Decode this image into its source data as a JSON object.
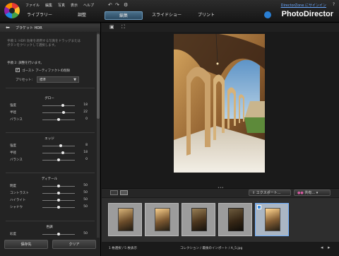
{
  "menu": [
    "ファイル",
    "編集",
    "写真",
    "表示",
    "ヘルプ"
  ],
  "signin": "DirectorZone にサインイン",
  "help": "?",
  "tabs": {
    "library": "ライブラリー",
    "adjust": "調整",
    "edit": "編集",
    "slideshow": "スライドショー",
    "print": "プリント"
  },
  "brand": "PhotoDirector",
  "panel": {
    "title": "ブラケット HDR",
    "intro": "手順 1: HDR 効果を適用する写真をドラッグまたは\nボタンをクリックして選択します。",
    "step2": "手順 2: 調整を行います。",
    "ghost_label": "ゴースト アーティファクトの削除",
    "preset_label": "プリセット:",
    "preset_value": "標準",
    "sections": [
      {
        "title": "グロー",
        "sliders": [
          {
            "label": "強度",
            "value": "18",
            "level": 0.62
          },
          {
            "label": "半径",
            "value": "22",
            "level": 0.66
          },
          {
            "label": "バランス",
            "value": "0",
            "level": 0.5
          }
        ]
      },
      {
        "title": "エッジ",
        "sliders": [
          {
            "label": "強度",
            "value": "8",
            "level": 0.56
          },
          {
            "label": "半径",
            "value": "18",
            "level": 0.62
          },
          {
            "label": "バランス",
            "value": "0",
            "level": 0.5
          }
        ]
      },
      {
        "title": "ディテール",
        "sliders": [
          {
            "label": "明度",
            "value": "50",
            "level": 0.5
          },
          {
            "label": "コントラスト",
            "value": "50",
            "level": 0.5
          },
          {
            "label": "ハイライト",
            "value": "50",
            "level": 0.5
          },
          {
            "label": "シャドウ",
            "value": "50",
            "level": 0.5
          }
        ]
      },
      {
        "title": "色調",
        "sliders": [
          {
            "label": "彩度",
            "value": "50",
            "level": 0.5
          }
        ]
      }
    ],
    "save_button": "保存先",
    "clear_button": "クリア"
  },
  "toolbar": {
    "export": "エクスポート...",
    "share": "共有..."
  },
  "status": {
    "selection": "1 枚選択 / 5 枚表示",
    "path": "コレクション / 最後のインポート / A_5.jpg"
  },
  "icons": [
    "back-arrow-icon",
    "compare-icon",
    "fullscreen-icon",
    "grid-view-icon",
    "list-view-icon",
    "export-icon",
    "share-icon",
    "undo-icon",
    "redo-icon",
    "settings-icon"
  ]
}
